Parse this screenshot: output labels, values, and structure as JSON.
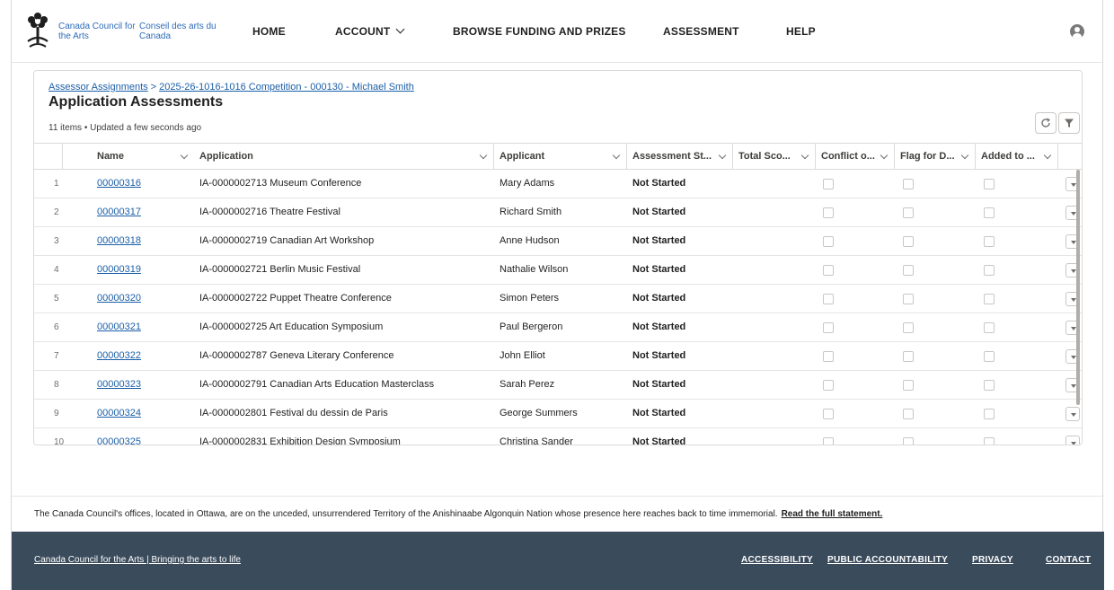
{
  "brand": {
    "name_en": "Canada Council for the Arts",
    "name_fr": "Conseil des arts du Canada"
  },
  "nav": {
    "items": [
      {
        "label": "HOME"
      },
      {
        "label": "ACCOUNT"
      },
      {
        "label": "BROWSE FUNDING AND PRIZES"
      },
      {
        "label": "ASSESSMENT"
      },
      {
        "label": "HELP"
      }
    ]
  },
  "breadcrumb": {
    "items": [
      "Assessor Assignments",
      "2025-26-1016-1016 Competition - 000130 - Michael Smith"
    ],
    "separator": ">"
  },
  "page": {
    "title": "Application Assessments",
    "meta": "11 items • Updated a few seconds ago"
  },
  "table": {
    "columns": [
      {
        "label": "Name"
      },
      {
        "label": "Application"
      },
      {
        "label": "Applicant"
      },
      {
        "label": "Assessment St..."
      },
      {
        "label": "Total Sco..."
      },
      {
        "label": "Conflict o..."
      },
      {
        "label": "Flag for D..."
      },
      {
        "label": "Added to ..."
      }
    ],
    "rows": [
      {
        "num": "1",
        "name": "00000316",
        "application": "IA-0000002713 Museum Conference",
        "applicant": "Mary Adams",
        "status": "Not Started"
      },
      {
        "num": "2",
        "name": "00000317",
        "application": "IA-0000002716 Theatre Festival",
        "applicant": "Richard Smith",
        "status": "Not Started"
      },
      {
        "num": "3",
        "name": "00000318",
        "application": "IA-0000002719 Canadian Art Workshop",
        "applicant": "Anne Hudson",
        "status": "Not Started"
      },
      {
        "num": "4",
        "name": "00000319",
        "application": "IA-0000002721 Berlin Music Festival",
        "applicant": "Nathalie Wilson",
        "status": "Not Started"
      },
      {
        "num": "5",
        "name": "00000320",
        "application": "IA-0000002722 Puppet Theatre Conference",
        "applicant": "Simon Peters",
        "status": "Not Started"
      },
      {
        "num": "6",
        "name": "00000321",
        "application": "IA-0000002725 Art Education Symposium",
        "applicant": "Paul Bergeron",
        "status": "Not Started"
      },
      {
        "num": "7",
        "name": "00000322",
        "application": "IA-0000002787 Geneva Literary Conference",
        "applicant": "John Elliot",
        "status": "Not Started"
      },
      {
        "num": "8",
        "name": "00000323",
        "application": "IA-0000002791 Canadian Arts Education Masterclass",
        "applicant": "Sarah Perez",
        "status": "Not Started"
      },
      {
        "num": "9",
        "name": "00000324",
        "application": "IA-0000002801 Festival du dessin de Paris",
        "applicant": "George Summers",
        "status": "Not Started"
      },
      {
        "num": "10",
        "name": "00000325",
        "application": "IA-0000002831 Exhibition Design Symposium",
        "applicant": "Christina Sander",
        "status": "Not Started"
      }
    ]
  },
  "land": {
    "text": "The Canada Council's offices, located in Ottawa, are on the unceded, unsurrendered Territory of the Anishinaabe Algonquin Nation whose presence here reaches back to time immemorial.",
    "link": "Read the full statement."
  },
  "footer": {
    "tagline": "Canada Council for the Arts | Bringing the arts to life",
    "links": [
      "ACCESSIBILITY",
      "PUBLIC ACCOUNTABILITY",
      "PRIVACY",
      "CONTACT"
    ]
  },
  "colors": {
    "link": "#1b5fa8",
    "brand_blue": "#2e6bb8",
    "footer_bg": "#3a4b5c"
  },
  "icons": [
    "canada-council-logo-icon",
    "chevron-down-icon",
    "user-avatar-icon",
    "refresh-icon",
    "filter-icon",
    "row-action-chevron-icon"
  ]
}
